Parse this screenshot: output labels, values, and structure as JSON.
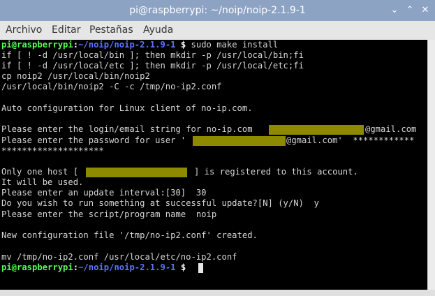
{
  "window": {
    "title": "pi@raspberrypi: ~/noip/noip-2.1.9-1",
    "minimize_glyph": "⌄",
    "maximize_glyph": "⌃",
    "close_glyph": "✕"
  },
  "menu": {
    "items": [
      "Archivo",
      "Editar",
      "Pestañas",
      "Ayuda"
    ]
  },
  "prompt": {
    "user": "pi@raspberrypi",
    "colon": ":",
    "path": "~/noip/noip-2.1.9-1",
    "dollar": " $"
  },
  "terminal": {
    "command": " sudo make install",
    "lines": [
      "if [ ! -d /usr/local/bin ]; then mkdir -p /usr/local/bin;fi",
      "if [ ! -d /usr/local/etc ]; then mkdir -p /usr/local/etc;fi",
      "cp noip2 /usr/local/bin/noip2",
      "/usr/local/bin/noip2 -C -c /tmp/no-ip2.conf",
      "",
      "Auto configuration for Linux client of no-ip.com.",
      "",
      "Please enter the login/email string for no-ip.com  ",
      "Please enter the password for user '",
      "********************",
      "",
      "Only one host [",
      "It will be used.",
      "Please enter an update interval:[30]  30",
      "Do you wish to run something at successful update?[N] (y/N)  y",
      "Please enter the script/program name  noip",
      "",
      "New configuration file '/tmp/no-ip2.conf' created.",
      "",
      "mv /tmp/no-ip2.conf /usr/local/etc/no-ip2.conf"
    ],
    "login_suffix": "@gmail.com",
    "password_suffix": "@gmail.com'  ************",
    "host_suffix": "] is registered to this account."
  },
  "colors": {
    "prompt_user": "#55ff55",
    "prompt_path": "#5b74ff",
    "redaction": "#8d8a00",
    "terminal_bg": "#000000",
    "titlebar": "#8ca3c4"
  }
}
